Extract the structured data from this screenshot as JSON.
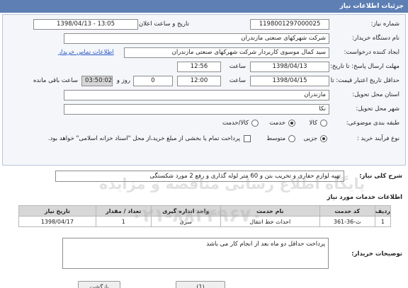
{
  "header": {
    "title": "جزئیات اطلاعات نیاز"
  },
  "form": {
    "need_number": {
      "label": "شماره نیاز:",
      "value": "1198001297000025"
    },
    "announce": {
      "label": "تاریخ و ساعت اعلان عمومی:",
      "value": "1398/04/13 - 13:05"
    },
    "buyer_org": {
      "label": "نام دستگاه خریدار:",
      "value": "شرکت شهرکهای صنعتی مازندران"
    },
    "creator": {
      "label": "ایجاد کننده درخواست:",
      "value": "سید کمال موسوی کاربردار شرکت شهرکهای صنعتی مازندران",
      "contact_link": "اطلاعات تماس خریدار"
    },
    "send_deadline": {
      "label": "مهلت ارسال پاسخ: تا تاریخ:",
      "date": "1398/04/13",
      "time_label": "ساعت",
      "time": "12:56"
    },
    "validity": {
      "label": "حداقل تاریخ اعتبار قیمت: تا تاریخ:",
      "date": "1398/04/15",
      "time_label": "ساعت",
      "time": "12:00",
      "days": "0",
      "days_label": "روز و",
      "remaining": "03:50:02",
      "remaining_label": "ساعت باقی مانده"
    },
    "province": {
      "label": "استان محل تحویل:",
      "value": "مازندران"
    },
    "city": {
      "label": "شهر محل تحویل:",
      "value": "نکا"
    },
    "category": {
      "label": "طبقه بندی موضوعی:",
      "options": [
        "کالا",
        "خدمت",
        "کالا/خدمت"
      ],
      "selected": "خدمت"
    },
    "process": {
      "label": "نوع فرآیند خرید :",
      "options": [
        "جزیی",
        "متوسط"
      ],
      "selected": "جزیی",
      "note": "پرداخت تمام یا بخشی از مبلغ خرید،از محل \"اسناد خزانه اسلامی\" خواهد بود."
    }
  },
  "need_summary": {
    "label": "شرح کلی نیاز:",
    "value": "تهیه لوازم  حفاری و تخریب بتن و  60 متر لوله گذاری و رفع 2 مورد شکستگی"
  },
  "services": {
    "title": "اطلاعات خدمات مورد نیاز",
    "columns": [
      "ردیف",
      "کد خدمت",
      "نام خدمت",
      "واحد اندازه گیری",
      "تعداد / مقدار",
      "تاریخ نیاز"
    ],
    "rows": [
      [
        "1",
        "ث-36-361",
        "احداث خط انتقال",
        "سری",
        "1",
        "1398/04/17"
      ]
    ]
  },
  "buyer_notes": {
    "label": "توضیحات خریدار:",
    "value": "پرداخت حداقل دو ماه بعد از انجام کار می باشد"
  },
  "watermark": {
    "text": "پایگاه اطلاع رسانی مناقصه و مزایده",
    "phone": "۰۲۱-۸۸۳۴۹۶۷۰"
  },
  "footer": {
    "button_1": "(1)",
    "button_2": "بازگشت"
  }
}
